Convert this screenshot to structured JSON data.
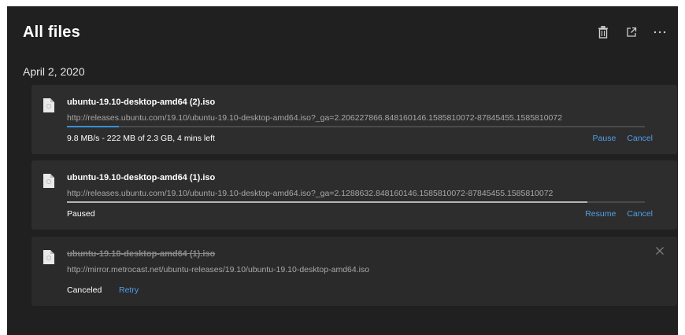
{
  "header": {
    "title": "All files",
    "actions": [
      "trash-icon",
      "open-external-icon",
      "more-icon"
    ]
  },
  "groups": [
    {
      "date": "April 2, 2020",
      "downloads": [
        {
          "name": "ubuntu-19.10-desktop-amd64 (2).iso",
          "url": "http://releases.ubuntu.com/19.10/ubuntu-19.10-desktop-amd64.iso?_ga=2.206227866.848160146.1585810072-87845455.1585810072",
          "status": "9.8 MB/s - 222 MB of 2.3 GB, 4 mins left",
          "progress": 0.09,
          "state": "downloading",
          "actions": {
            "primary": "Pause",
            "secondary": "Cancel"
          }
        },
        {
          "name": "ubuntu-19.10-desktop-amd64 (1).iso",
          "url": "http://releases.ubuntu.com/19.10/ubuntu-19.10-desktop-amd64.iso?_ga=2.1288632.848160146.1585810072-87845455.1585810072",
          "status": "Paused",
          "progress": 0.9,
          "state": "paused",
          "actions": {
            "primary": "Resume",
            "secondary": "Cancel"
          }
        },
        {
          "name": "ubuntu-19.10-desktop-amd64 (1).iso",
          "url": "http://mirror.metrocast.net/ubuntu-releases/19.10/ubuntu-19.10-desktop-amd64.iso",
          "status": "Canceled",
          "state": "canceled",
          "actions": {
            "primary": "Retry"
          }
        }
      ]
    }
  ],
  "colors": {
    "background": "#202020",
    "card": "#2d2d2d",
    "accent": "#4ea0e8",
    "progress": "#3a8fd9"
  }
}
